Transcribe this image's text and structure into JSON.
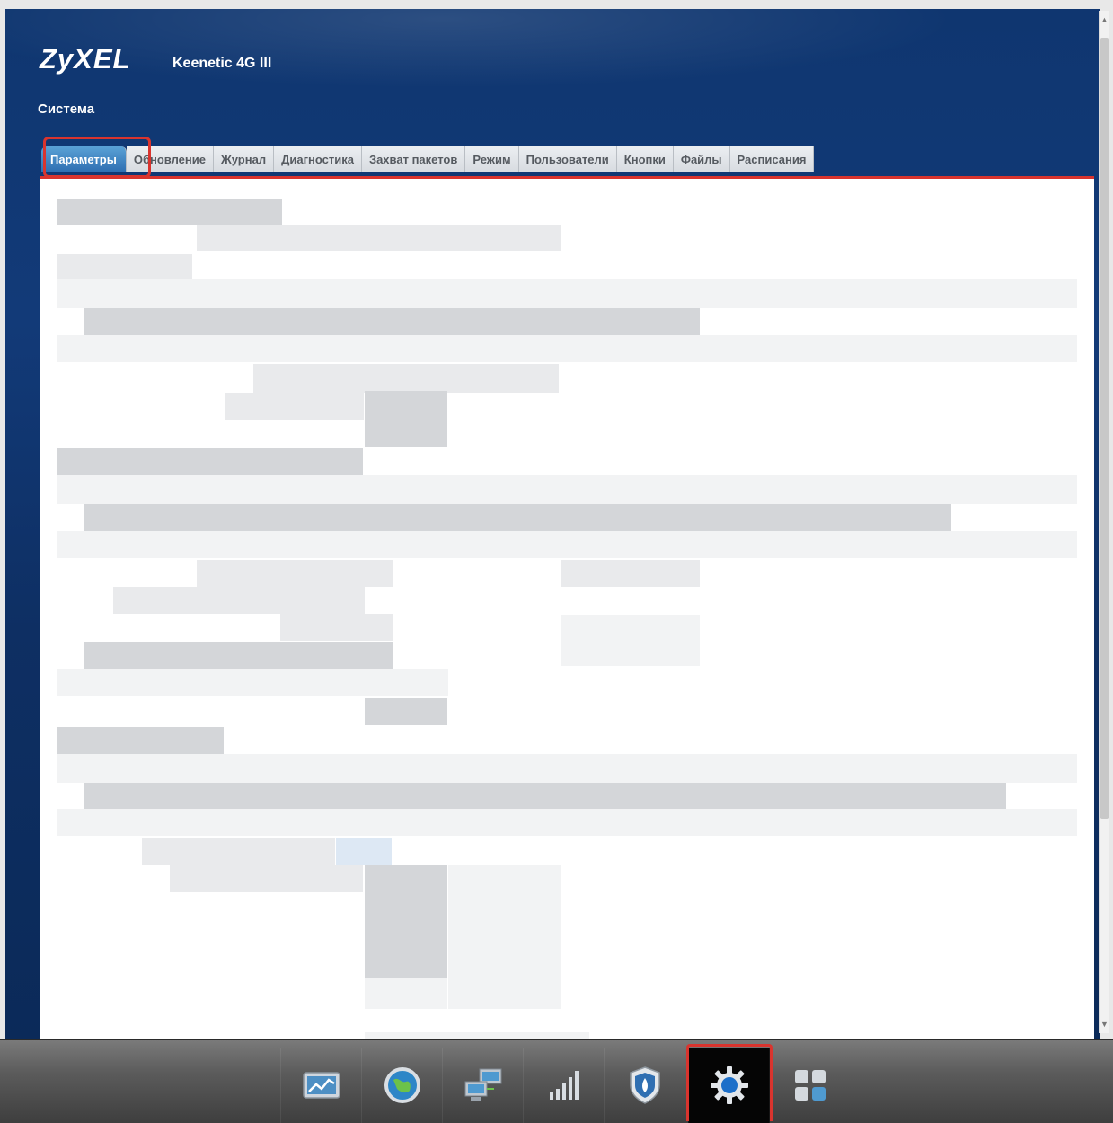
{
  "header": {
    "logo": "ZyXEL",
    "model": "Keenetic 4G III",
    "section_title": "Система"
  },
  "tabs": [
    {
      "label": "Параметры",
      "active": true
    },
    {
      "label": "Обновление",
      "active": false
    },
    {
      "label": "Журнал",
      "active": false
    },
    {
      "label": "Диагностика",
      "active": false
    },
    {
      "label": "Захват пакетов",
      "active": false
    },
    {
      "label": "Режим",
      "active": false
    },
    {
      "label": "Пользователи",
      "active": false
    },
    {
      "label": "Кнопки",
      "active": false
    },
    {
      "label": "Файлы",
      "active": false
    },
    {
      "label": "Расписания",
      "active": false
    }
  ],
  "dock": {
    "items": [
      {
        "icon": "monitor-chart-icon",
        "active": false
      },
      {
        "icon": "globe-icon",
        "active": false
      },
      {
        "icon": "network-computers-icon",
        "active": false
      },
      {
        "icon": "signal-bars-icon",
        "active": false
      },
      {
        "icon": "shield-icon",
        "active": false
      },
      {
        "icon": "gear-icon",
        "active": true
      },
      {
        "icon": "apps-grid-icon",
        "active": false
      }
    ]
  },
  "colors": {
    "header_bg": "#123a78",
    "tab_active": "#2f6fb2",
    "highlight": "#d9342e",
    "dock_bg": "#5b5b5b"
  }
}
